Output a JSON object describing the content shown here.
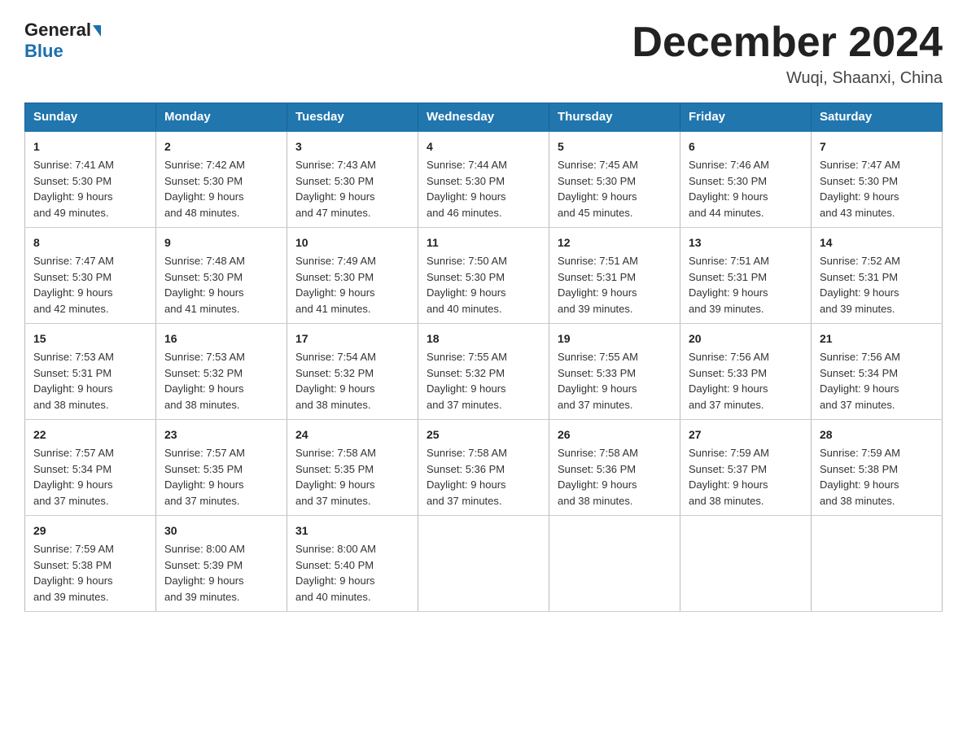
{
  "header": {
    "logo_general": "General",
    "logo_blue": "Blue",
    "month_title": "December 2024",
    "location": "Wuqi, Shaanxi, China"
  },
  "days_of_week": [
    "Sunday",
    "Monday",
    "Tuesday",
    "Wednesday",
    "Thursday",
    "Friday",
    "Saturday"
  ],
  "weeks": [
    [
      {
        "day": "1",
        "sunrise": "7:41 AM",
        "sunset": "5:30 PM",
        "daylight": "9 hours and 49 minutes."
      },
      {
        "day": "2",
        "sunrise": "7:42 AM",
        "sunset": "5:30 PM",
        "daylight": "9 hours and 48 minutes."
      },
      {
        "day": "3",
        "sunrise": "7:43 AM",
        "sunset": "5:30 PM",
        "daylight": "9 hours and 47 minutes."
      },
      {
        "day": "4",
        "sunrise": "7:44 AM",
        "sunset": "5:30 PM",
        "daylight": "9 hours and 46 minutes."
      },
      {
        "day": "5",
        "sunrise": "7:45 AM",
        "sunset": "5:30 PM",
        "daylight": "9 hours and 45 minutes."
      },
      {
        "day": "6",
        "sunrise": "7:46 AM",
        "sunset": "5:30 PM",
        "daylight": "9 hours and 44 minutes."
      },
      {
        "day": "7",
        "sunrise": "7:47 AM",
        "sunset": "5:30 PM",
        "daylight": "9 hours and 43 minutes."
      }
    ],
    [
      {
        "day": "8",
        "sunrise": "7:47 AM",
        "sunset": "5:30 PM",
        "daylight": "9 hours and 42 minutes."
      },
      {
        "day": "9",
        "sunrise": "7:48 AM",
        "sunset": "5:30 PM",
        "daylight": "9 hours and 41 minutes."
      },
      {
        "day": "10",
        "sunrise": "7:49 AM",
        "sunset": "5:30 PM",
        "daylight": "9 hours and 41 minutes."
      },
      {
        "day": "11",
        "sunrise": "7:50 AM",
        "sunset": "5:30 PM",
        "daylight": "9 hours and 40 minutes."
      },
      {
        "day": "12",
        "sunrise": "7:51 AM",
        "sunset": "5:31 PM",
        "daylight": "9 hours and 39 minutes."
      },
      {
        "day": "13",
        "sunrise": "7:51 AM",
        "sunset": "5:31 PM",
        "daylight": "9 hours and 39 minutes."
      },
      {
        "day": "14",
        "sunrise": "7:52 AM",
        "sunset": "5:31 PM",
        "daylight": "9 hours and 39 minutes."
      }
    ],
    [
      {
        "day": "15",
        "sunrise": "7:53 AM",
        "sunset": "5:31 PM",
        "daylight": "9 hours and 38 minutes."
      },
      {
        "day": "16",
        "sunrise": "7:53 AM",
        "sunset": "5:32 PM",
        "daylight": "9 hours and 38 minutes."
      },
      {
        "day": "17",
        "sunrise": "7:54 AM",
        "sunset": "5:32 PM",
        "daylight": "9 hours and 38 minutes."
      },
      {
        "day": "18",
        "sunrise": "7:55 AM",
        "sunset": "5:32 PM",
        "daylight": "9 hours and 37 minutes."
      },
      {
        "day": "19",
        "sunrise": "7:55 AM",
        "sunset": "5:33 PM",
        "daylight": "9 hours and 37 minutes."
      },
      {
        "day": "20",
        "sunrise": "7:56 AM",
        "sunset": "5:33 PM",
        "daylight": "9 hours and 37 minutes."
      },
      {
        "day": "21",
        "sunrise": "7:56 AM",
        "sunset": "5:34 PM",
        "daylight": "9 hours and 37 minutes."
      }
    ],
    [
      {
        "day": "22",
        "sunrise": "7:57 AM",
        "sunset": "5:34 PM",
        "daylight": "9 hours and 37 minutes."
      },
      {
        "day": "23",
        "sunrise": "7:57 AM",
        "sunset": "5:35 PM",
        "daylight": "9 hours and 37 minutes."
      },
      {
        "day": "24",
        "sunrise": "7:58 AM",
        "sunset": "5:35 PM",
        "daylight": "9 hours and 37 minutes."
      },
      {
        "day": "25",
        "sunrise": "7:58 AM",
        "sunset": "5:36 PM",
        "daylight": "9 hours and 37 minutes."
      },
      {
        "day": "26",
        "sunrise": "7:58 AM",
        "sunset": "5:36 PM",
        "daylight": "9 hours and 38 minutes."
      },
      {
        "day": "27",
        "sunrise": "7:59 AM",
        "sunset": "5:37 PM",
        "daylight": "9 hours and 38 minutes."
      },
      {
        "day": "28",
        "sunrise": "7:59 AM",
        "sunset": "5:38 PM",
        "daylight": "9 hours and 38 minutes."
      }
    ],
    [
      {
        "day": "29",
        "sunrise": "7:59 AM",
        "sunset": "5:38 PM",
        "daylight": "9 hours and 39 minutes."
      },
      {
        "day": "30",
        "sunrise": "8:00 AM",
        "sunset": "5:39 PM",
        "daylight": "9 hours and 39 minutes."
      },
      {
        "day": "31",
        "sunrise": "8:00 AM",
        "sunset": "5:40 PM",
        "daylight": "9 hours and 40 minutes."
      },
      null,
      null,
      null,
      null
    ]
  ],
  "labels": {
    "sunrise": "Sunrise:",
    "sunset": "Sunset:",
    "daylight": "Daylight:"
  }
}
